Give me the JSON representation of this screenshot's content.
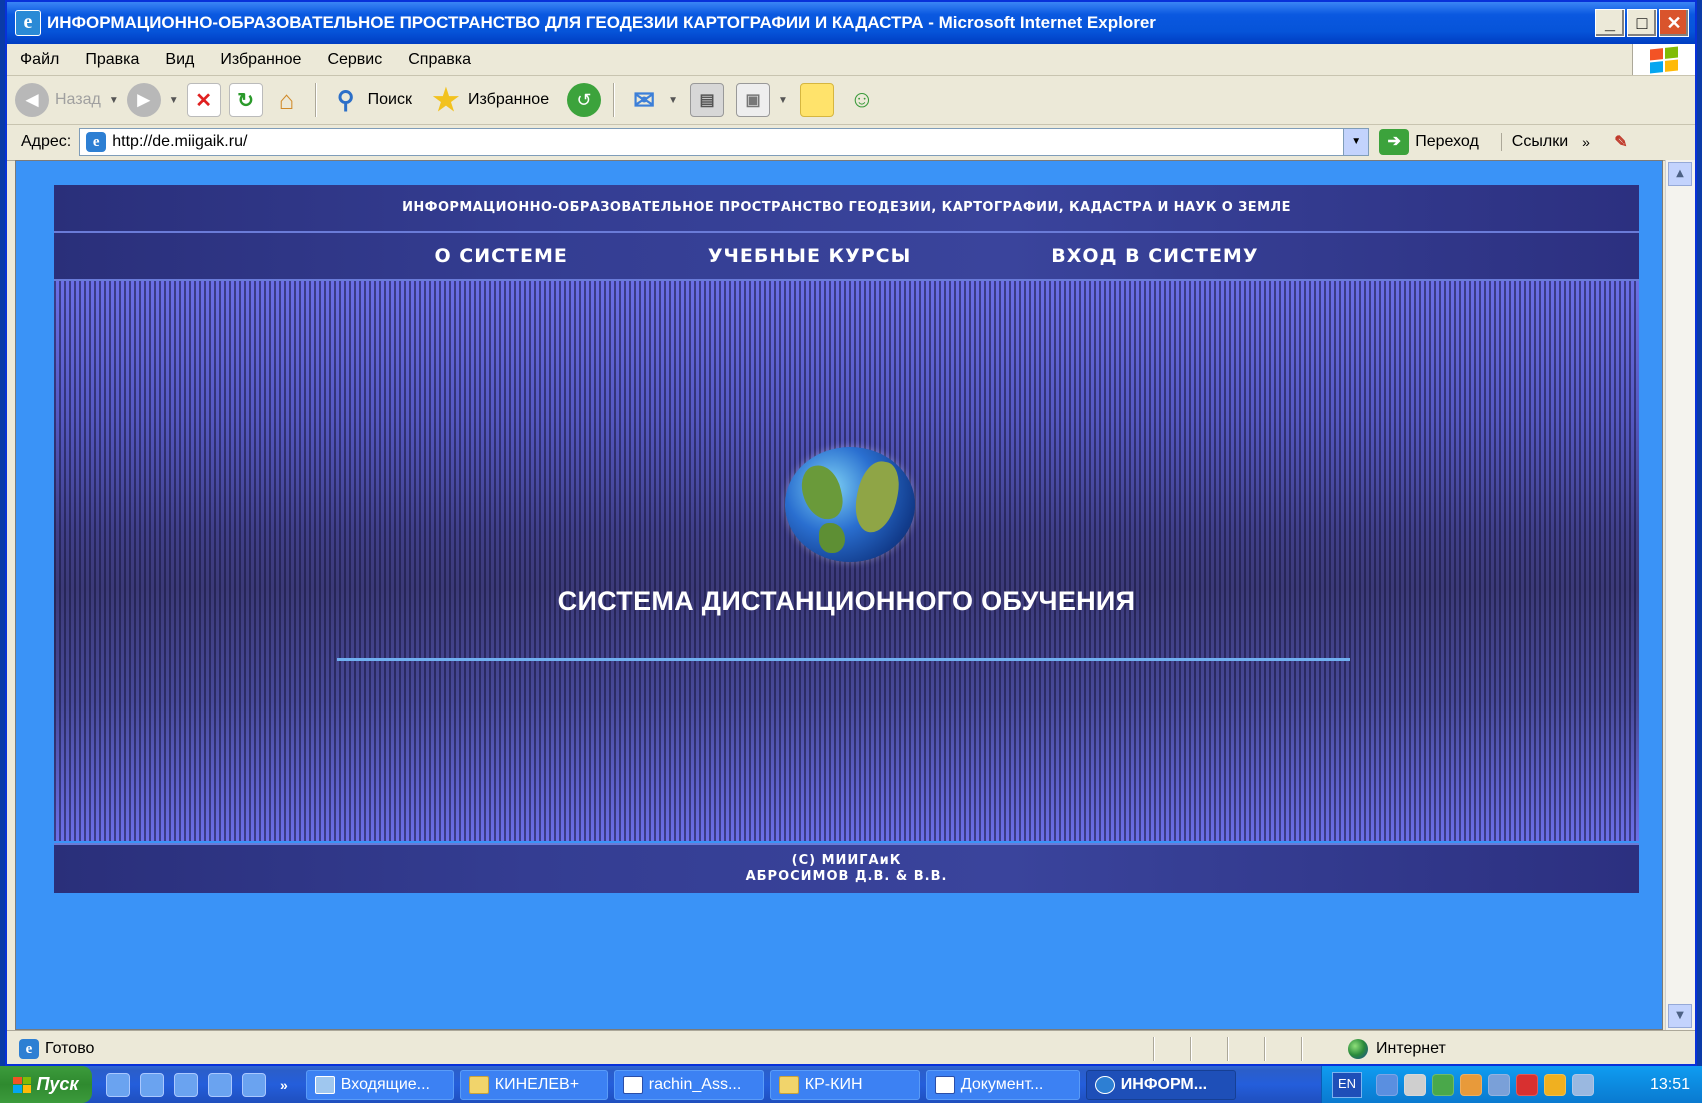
{
  "window": {
    "title": "ИНФОРМАЦИОННО-ОБРАЗОВАТЕЛЬНОЕ ПРОСТРАНСТВО ДЛЯ ГЕОДЕЗИИ КАРТОГРАФИИ И КАДАСТРА - Microsoft Internet Explorer",
    "minimize": "_",
    "maximize": "□",
    "close": "✕"
  },
  "menu": [
    "Файл",
    "Правка",
    "Вид",
    "Избранное",
    "Сервис",
    "Справка"
  ],
  "toolbar": {
    "back": "Назад",
    "search": "Поиск",
    "favorites": "Избранное"
  },
  "address": {
    "label": "Адрес:",
    "url": "http://de.miigaik.ru/",
    "go": "Переход",
    "links": "Ссылки",
    "more": "»"
  },
  "site": {
    "header": "ИНФОРМАЦИОННО-ОБРАЗОВАТЕЛЬНОЕ ПРОСТРАНСТВО ГЕОДЕЗИИ, КАРТОГРАФИИ, КАДАСТРА И НАУК О ЗЕМЛЕ",
    "nav": [
      "О СИСТЕМЕ",
      "УЧЕБНЫЕ КУРСЫ",
      "ВХОД В СИСТЕМУ"
    ],
    "title": "СИСТЕМА ДИСТАНЦИОННОГО ОБУЧЕНИЯ",
    "footer_line1": "(С) МИИГАиК",
    "footer_line2": "АБРОСИМОВ Д.В. &  В.В."
  },
  "status": {
    "text": "Готово",
    "zone": "Интернет"
  },
  "taskbar": {
    "start": "Пуск",
    "more": "»",
    "tasks": [
      "Входящие...",
      "КИНЕЛЕВ+",
      "rachin_Ass...",
      "КР-КИН",
      "Документ...",
      "ИНФОРМ..."
    ],
    "lang": "EN",
    "clock": "13:51"
  },
  "colors": {
    "page_background": "#3a93f7",
    "site_bar": "#343d92",
    "accent_line": "#6fb0f0"
  }
}
